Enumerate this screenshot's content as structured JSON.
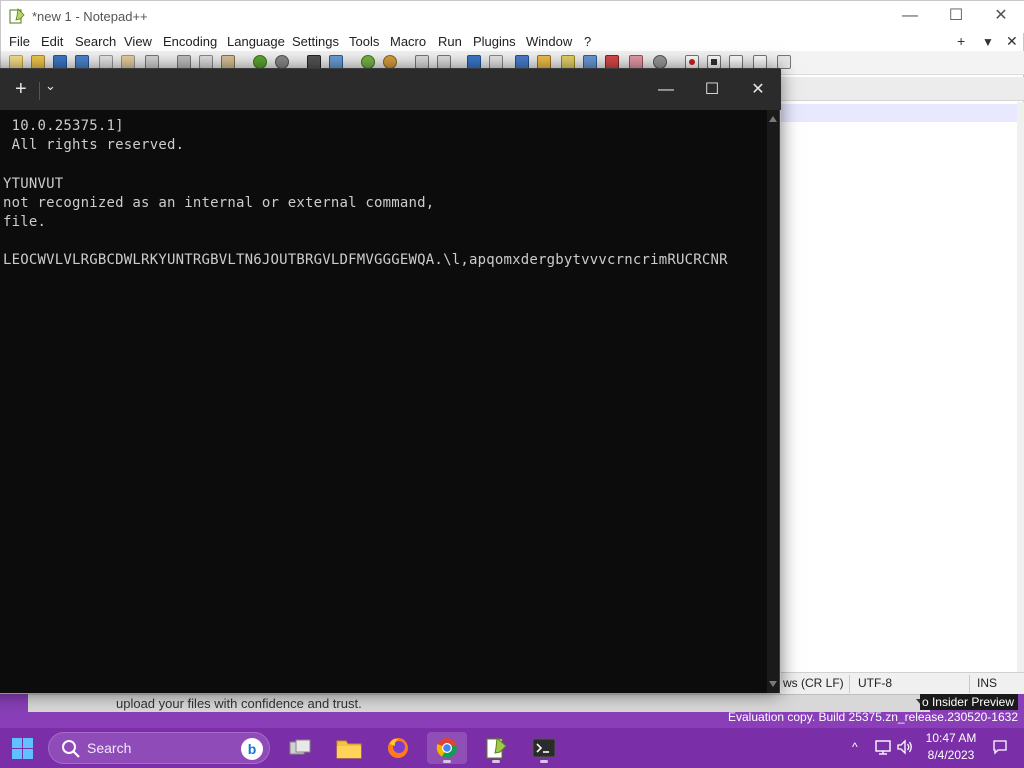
{
  "notepad": {
    "title": "*new 1 - Notepad++",
    "menu": [
      "File",
      "Edit",
      "Search",
      "View",
      "Encoding",
      "Language",
      "Settings",
      "Tools",
      "Macro",
      "Run",
      "Plugins",
      "Window",
      "?"
    ],
    "menu_right": [
      "+",
      "▼",
      "✕"
    ],
    "status": {
      "eol": "ws (CR LF)",
      "encoding": "UTF-8",
      "mode": "INS"
    },
    "window_controls": {
      "minimize": "—",
      "maximize": "☐",
      "close": "✕"
    }
  },
  "terminal": {
    "tab_plus": "+",
    "tab_dropdown": "⌄",
    "window_controls": {
      "minimize": "—",
      "maximize": "☐",
      "close": "✕"
    },
    "lines": [
      " 10.0.25375.1]",
      " All rights reserved.",
      "",
      "YTUNVUT",
      "not recognized as an internal or external command,",
      "file.",
      "",
      "LEOCWVLVLRGBCDWLRKYUNTRGBVLTN6JOUTBRGVLDFMVGGGEWQA.\\l,apqomxdergbytvvvcrncrimRUCRCNR"
    ]
  },
  "browser_behind": {
    "text": "upload your files with confidence and trust."
  },
  "watermark": {
    "line1": "o Insider Preview",
    "line2": "Evaluation copy. Build 25375.zn_release.230520-1632"
  },
  "taskbar": {
    "search_label": "Search",
    "bing_letter": "b",
    "clock_time": "10:47 AM",
    "clock_date": "8/4/2023",
    "tray_arrow": "^"
  },
  "colors": {
    "taskbar": "#7a2ea7",
    "terminal_bg": "#0c0c0c",
    "terminal_text": "#cccccc",
    "accent": "#5fc2ff"
  }
}
